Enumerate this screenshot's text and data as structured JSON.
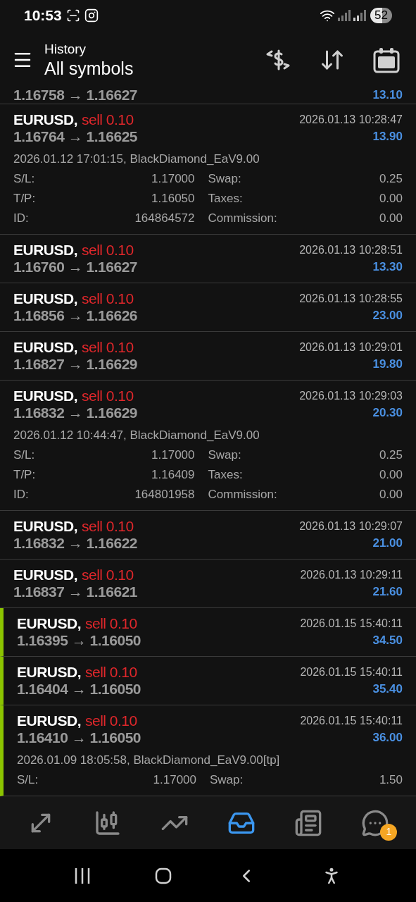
{
  "status_bar": {
    "time": "10:53",
    "battery": "52"
  },
  "header": {
    "title": "History",
    "subtitle": "All symbols"
  },
  "deals": [
    {
      "price": "1.16758 → 1.16627",
      "profit": "13.10",
      "marked": false
    },
    {
      "symbol": "EURUSD,",
      "side": "sell 0.10",
      "time": "2026.01.13 10:28:47",
      "price": "1.16764 → 1.16625",
      "profit": "13.90",
      "marked": false,
      "expanded": true,
      "comment": "2026.01.12 17:01:15, BlackDiamond_EaV9.00",
      "details": [
        {
          "label": "S/L:",
          "value": "1.17000",
          "label_2": "Swap:",
          "value_2": "0.25"
        },
        {
          "label": "T/P:",
          "value": "1.16050",
          "label_2": "Taxes:",
          "value_2": "0.00"
        },
        {
          "label": "ID:",
          "value": "164864572",
          "label_2": "Commission:",
          "value_2": "0.00"
        }
      ]
    },
    {
      "symbol": "EURUSD,",
      "side": "sell 0.10",
      "time": "2026.01.13 10:28:51",
      "price": "1.16760 → 1.16627",
      "profit": "13.30",
      "marked": false,
      "expanded": false
    },
    {
      "symbol": "EURUSD,",
      "side": "sell 0.10",
      "time": "2026.01.13 10:28:55",
      "price": "1.16856 → 1.16626",
      "profit": "23.00",
      "marked": false,
      "expanded": false
    },
    {
      "symbol": "EURUSD,",
      "side": "sell 0.10",
      "time": "2026.01.13 10:29:01",
      "price": "1.16827 → 1.16629",
      "profit": "19.80",
      "marked": false,
      "expanded": false
    },
    {
      "symbol": "EURUSD,",
      "side": "sell 0.10",
      "time": "2026.01.13 10:29:03",
      "price": "1.16832 → 1.16629",
      "profit": "20.30",
      "marked": false,
      "expanded": true,
      "comment": "2026.01.12 10:44:47, BlackDiamond_EaV9.00",
      "details": [
        {
          "label": "S/L:",
          "value": "1.17000",
          "label_2": "Swap:",
          "value_2": "0.25"
        },
        {
          "label": "T/P:",
          "value": "1.16409",
          "label_2": "Taxes:",
          "value_2": "0.00"
        },
        {
          "label": "ID:",
          "value": "164801958",
          "label_2": "Commission:",
          "value_2": "0.00"
        }
      ]
    },
    {
      "symbol": "EURUSD,",
      "side": "sell 0.10",
      "time": "2026.01.13 10:29:07",
      "price": "1.16832 → 1.16622",
      "profit": "21.00",
      "marked": false,
      "expanded": false
    },
    {
      "symbol": "EURUSD,",
      "side": "sell 0.10",
      "time": "2026.01.13 10:29:11",
      "price": "1.16837 → 1.16621",
      "profit": "21.60",
      "marked": false,
      "expanded": false
    },
    {
      "symbol": "EURUSD,",
      "side": "sell 0.10",
      "time": "2026.01.15 15:40:11",
      "price": "1.16395 → 1.16050",
      "profit": "34.50",
      "marked": true,
      "expanded": false
    },
    {
      "symbol": "EURUSD,",
      "side": "sell 0.10",
      "time": "2026.01.15 15:40:11",
      "price": "1.16404 → 1.16050",
      "profit": "35.40",
      "marked": true,
      "expanded": false
    },
    {
      "symbol": "EURUSD,",
      "side": "sell 0.10",
      "time": "2026.01.15 15:40:11",
      "price": "1.16410 → 1.16050",
      "profit": "36.00",
      "marked": true,
      "expanded": true,
      "comment": "2026.01.09 18:05:58, BlackDiamond_EaV9.00[tp]",
      "details": [
        {
          "label": "S/L:",
          "value": "1.17000",
          "label_2": "Swap:",
          "value_2": "1.50"
        }
      ]
    }
  ],
  "bottom_nav": [
    {
      "kind": "trade",
      "selected": false
    },
    {
      "kind": "quotes",
      "selected": false
    },
    {
      "kind": "chart",
      "selected": false
    },
    {
      "kind": "history",
      "selected": true
    },
    {
      "kind": "news",
      "selected": false
    },
    {
      "kind": "chat",
      "selected": false,
      "badge": "1"
    }
  ]
}
